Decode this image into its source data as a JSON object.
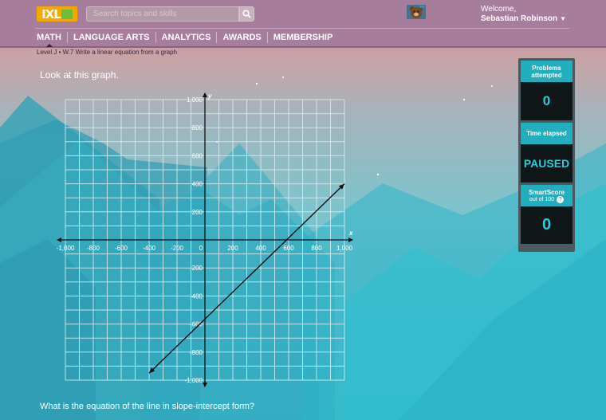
{
  "header": {
    "search_placeholder": "Search topics and skills",
    "welcome_label": "Welcome,",
    "user_name": "Sebastian Robinson",
    "nav": [
      "MATH",
      "LANGUAGE ARTS",
      "ANALYTICS",
      "AWARDS",
      "MEMBERSHIP"
    ]
  },
  "breadcrumb": "Level J  •  W.7 Write a linear equation from a graph",
  "prompt": "Look at this graph.",
  "question": "What is the equation of the line in slope-intercept form?",
  "stats": {
    "problems_label": "Problems attempted",
    "problems_value": "0",
    "time_label": "Time elapsed",
    "time_value": "PAUSED",
    "smartscore_label": "SmartScore",
    "smartscore_sub": "out of 100",
    "smartscore_value": "0"
  },
  "colors": {
    "logo": "#f7a800",
    "accent": "#22aebc",
    "value_text": "#1fd0dc"
  },
  "chart_data": {
    "type": "line",
    "xlabel": "x",
    "ylabel": "y",
    "xlim": [
      -1000,
      1000
    ],
    "ylim": [
      -1000,
      1000
    ],
    "grid": true,
    "x_ticks": [
      "-1,000",
      "-800",
      "-600",
      "-400",
      "-200",
      "0",
      "200",
      "400",
      "600",
      "800",
      "1,000"
    ],
    "y_ticks": [
      "1,000",
      "800",
      "600",
      "400",
      "200",
      "-200",
      "-400",
      "-600",
      "-800",
      "-1,000"
    ],
    "series": [
      {
        "x": [
          -400,
          1000
        ],
        "y": [
          -950,
          400
        ]
      }
    ]
  }
}
